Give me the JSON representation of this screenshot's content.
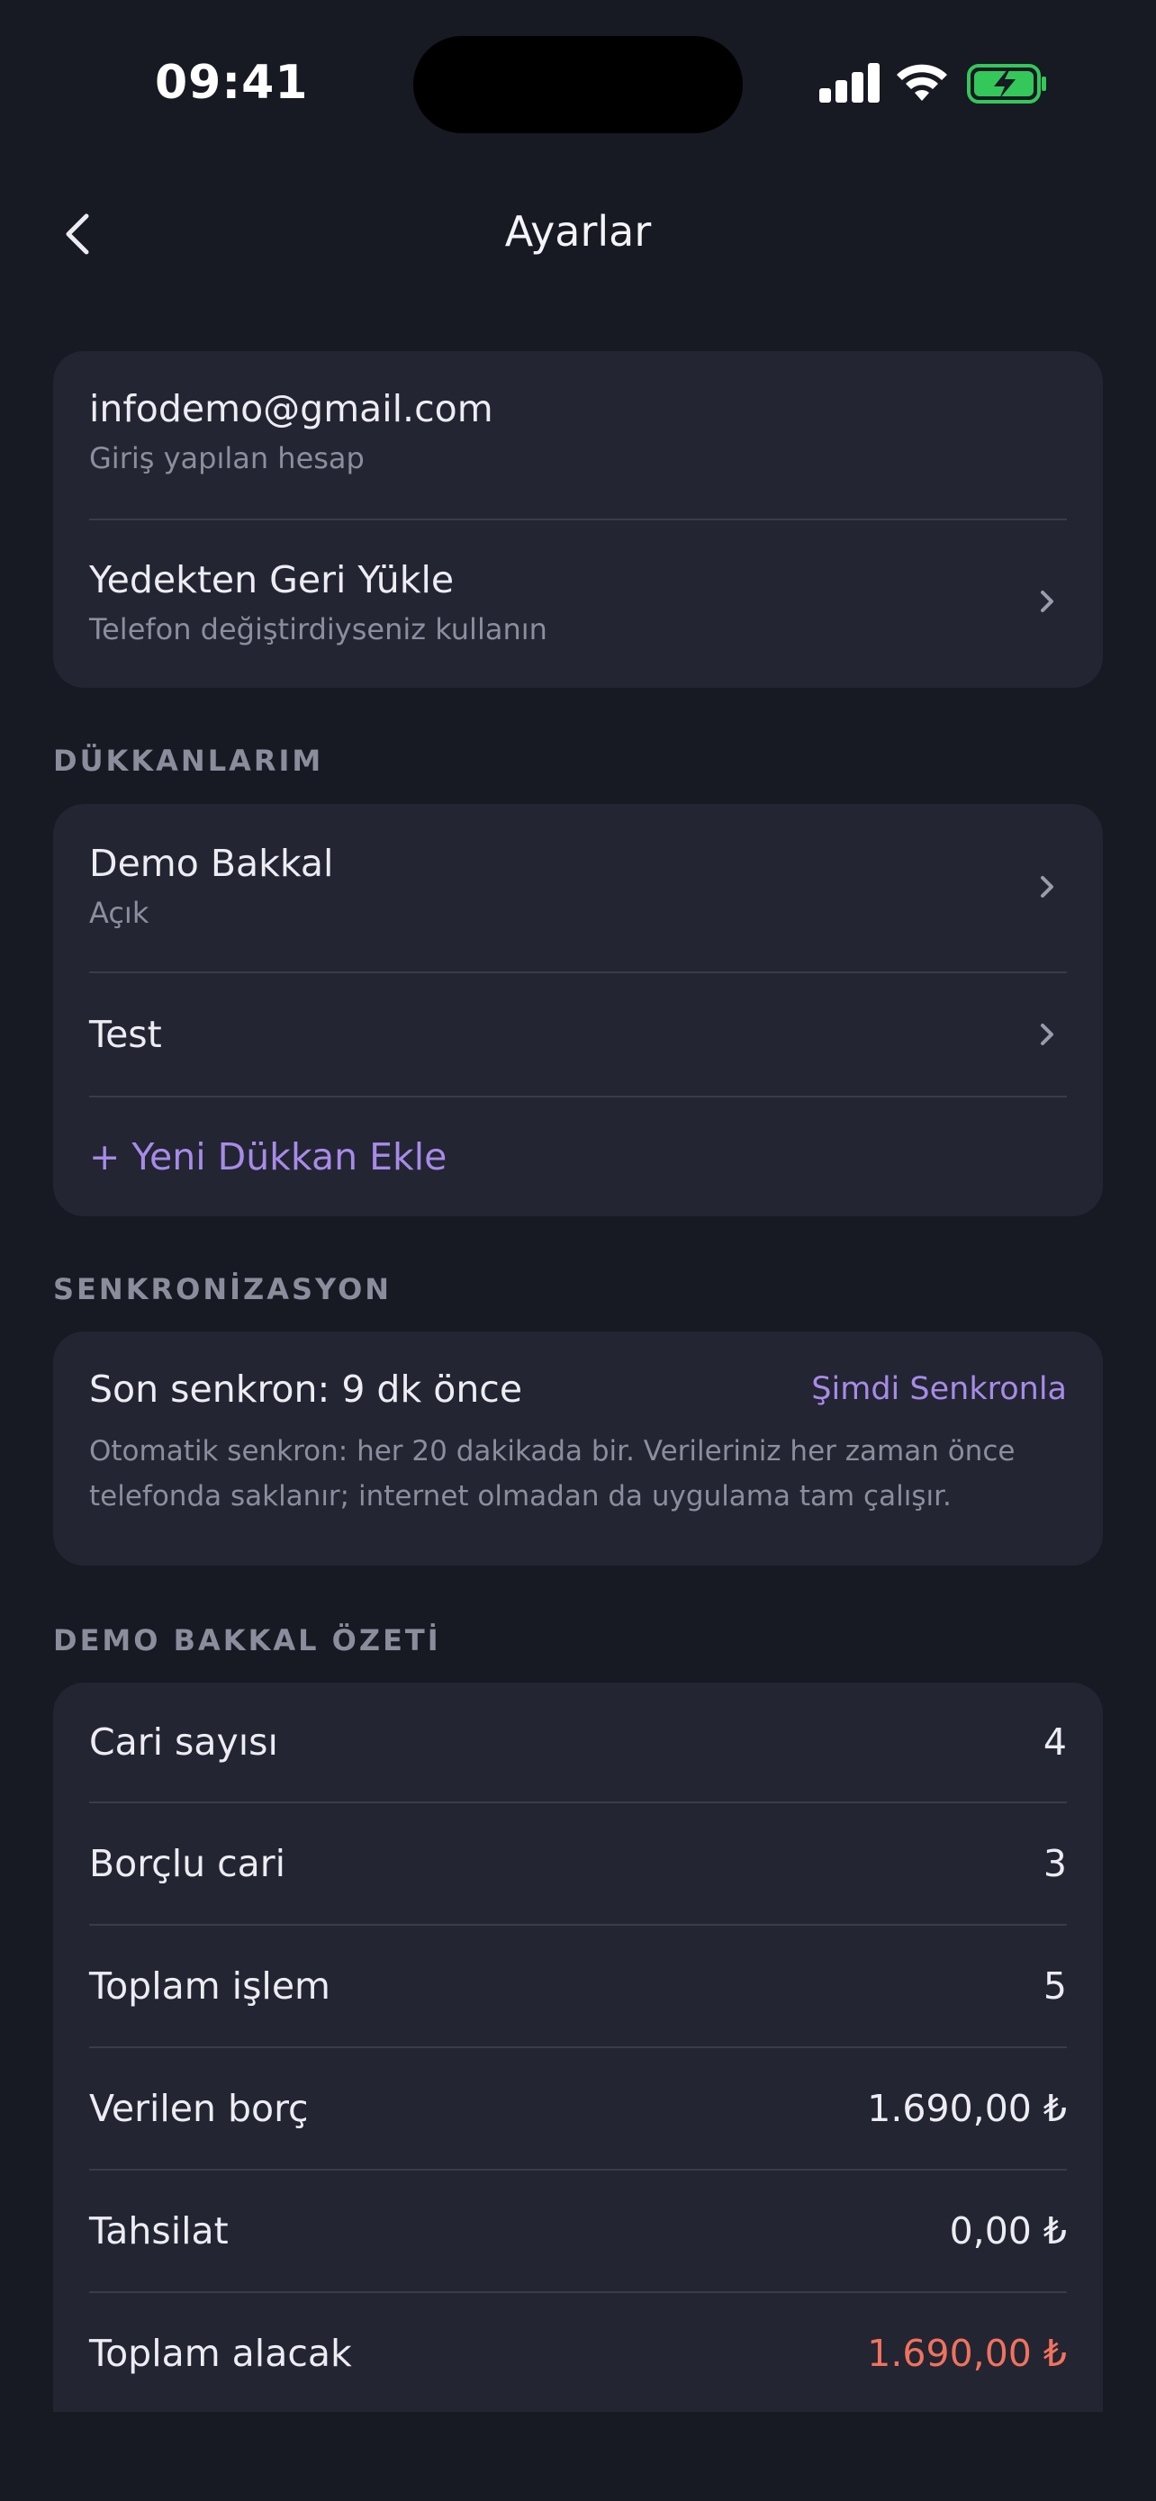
{
  "status_bar": {
    "time": "09:41"
  },
  "nav": {
    "title": "Ayarlar"
  },
  "account": {
    "email": "infodemo@gmail.com",
    "email_caption": "Giriş yapılan hesap",
    "restore_title": "Yedekten Geri Yükle",
    "restore_caption": "Telefon değiştirdiyseniz kullanın"
  },
  "shops": {
    "header": "DÜKKANLARIM",
    "items": [
      {
        "name": "Demo Bakkal",
        "status": "Açık"
      },
      {
        "name": "Test"
      }
    ],
    "add_label": "+ Yeni Dükkan Ekle"
  },
  "sync": {
    "header": "SENKRONİZASYON",
    "last_sync": "Son senkron: 9 dk önce",
    "sync_now": "Şimdi Senkronla",
    "description": "Otomatik senkron: her 20 dakikada bir. Verileriniz her zaman önce telefonda saklanır; internet olmadan da uygulama tam çalışır."
  },
  "summary": {
    "header": "DEMO BAKKAL ÖZETİ",
    "rows": [
      {
        "label": "Cari sayısı",
        "value": "4"
      },
      {
        "label": "Borçlu cari",
        "value": "3"
      },
      {
        "label": "Toplam işlem",
        "value": "5"
      },
      {
        "label": "Verilen borç",
        "value": "1.690,00 ₺"
      },
      {
        "label": "Tahsilat",
        "value": "0,00 ₺"
      },
      {
        "label": "Toplam alacak",
        "value": "1.690,00 ₺"
      }
    ]
  },
  "colors": {
    "background": "#171923",
    "card": "#232532",
    "accent": "#A78BE8",
    "danger": "#F1725D",
    "battery_green": "#34C759"
  },
  "icons": [
    "back-chevron-icon",
    "chevron-right-icon",
    "cellular-signal-icon",
    "wifi-icon",
    "battery-charging-icon"
  ]
}
